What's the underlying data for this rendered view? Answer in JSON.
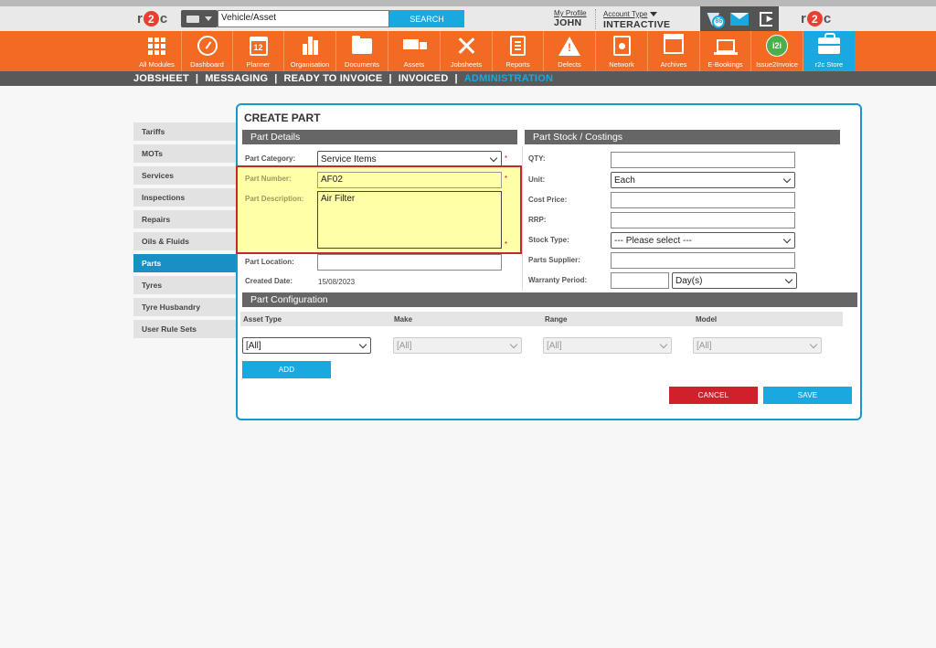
{
  "header": {
    "logo_left": {
      "r": "r",
      "two": "2",
      "c": "c"
    },
    "logo_right": {
      "r": "r",
      "two": "2",
      "c": "c"
    },
    "search": {
      "value": "Vehicle/Asset",
      "button": "SEARCH"
    },
    "profile": {
      "label": "My Profile",
      "user": "JOHN"
    },
    "account": {
      "label": "Account Type",
      "value": "INTERACTIVE"
    },
    "notifications_count": "86"
  },
  "nav": [
    {
      "label": "All Modules",
      "icon": "grid-icon"
    },
    {
      "label": "Dashboard",
      "icon": "gauge-icon"
    },
    {
      "label": "Planner",
      "icon": "calendar-icon",
      "icon_text": "12"
    },
    {
      "label": "Organisation",
      "icon": "buildings-icon"
    },
    {
      "label": "Documents",
      "icon": "folder-icon"
    },
    {
      "label": "Assets",
      "icon": "truck-icon"
    },
    {
      "label": "Jobsheets",
      "icon": "tools-icon"
    },
    {
      "label": "Reports",
      "icon": "clipboard-icon"
    },
    {
      "label": "Defects",
      "icon": "warning-icon"
    },
    {
      "label": "Network",
      "icon": "contacts-icon"
    },
    {
      "label": "Archives",
      "icon": "archive-icon"
    },
    {
      "label": "E-Bookings",
      "icon": "laptop-icon"
    },
    {
      "label": "Issue2Invoice",
      "icon": "i2i-icon",
      "icon_text": "i2i"
    },
    {
      "label": "r2c Store",
      "icon": "store-icon"
    }
  ],
  "subnav": {
    "items": [
      "JOBSHEET",
      "MESSAGING",
      "READY TO INVOICE",
      "INVOICED",
      "ADMINISTRATION"
    ],
    "separator": "|",
    "active": "ADMINISTRATION"
  },
  "sidebar": [
    "Tariffs",
    "MOTs",
    "Services",
    "Inspections",
    "Repairs",
    "Oils & Fluids",
    "Parts",
    "Tyres",
    "Tyre Husbandry",
    "User Rule Sets"
  ],
  "sidebar_active": "Parts",
  "form": {
    "title": "CREATE PART",
    "details_header": "Part Details",
    "stock_header": "Part Stock / Costings",
    "config_header": "Part Configuration",
    "required_mark": "*",
    "part_category": {
      "label": "Part Category:",
      "value": "Service Items"
    },
    "part_number": {
      "label": "Part Number:",
      "value": "AF02"
    },
    "part_description": {
      "label": "Part Description:",
      "value": "Air Filter"
    },
    "part_location": {
      "label": "Part Location:",
      "value": ""
    },
    "created_date": {
      "label": "Created Date:",
      "value": "15/08/2023"
    },
    "qty": {
      "label": "QTY:",
      "value": ""
    },
    "unit": {
      "label": "Unit:",
      "value": "Each"
    },
    "cost_price": {
      "label": "Cost Price:",
      "value": ""
    },
    "rrp": {
      "label": "RRP:",
      "value": ""
    },
    "stock_type": {
      "label": "Stock Type:",
      "value": "--- Please select ---"
    },
    "parts_supplier": {
      "label": "Parts Supplier:",
      "value": ""
    },
    "warranty_period": {
      "label": "Warranty Period:",
      "value": "",
      "unit": "Day(s)"
    },
    "config": {
      "columns": [
        "Asset Type",
        "Make",
        "Range",
        "Model"
      ],
      "values": [
        "[All]",
        "[All]",
        "[All]",
        "[All]"
      ],
      "add_button": "ADD"
    },
    "cancel_button": "CANCEL",
    "save_button": "SAVE"
  },
  "colors": {
    "orange": "#f36b22",
    "blue": "#1aa8e0",
    "red": "#d0202c",
    "highlight": "#ffffa8"
  }
}
